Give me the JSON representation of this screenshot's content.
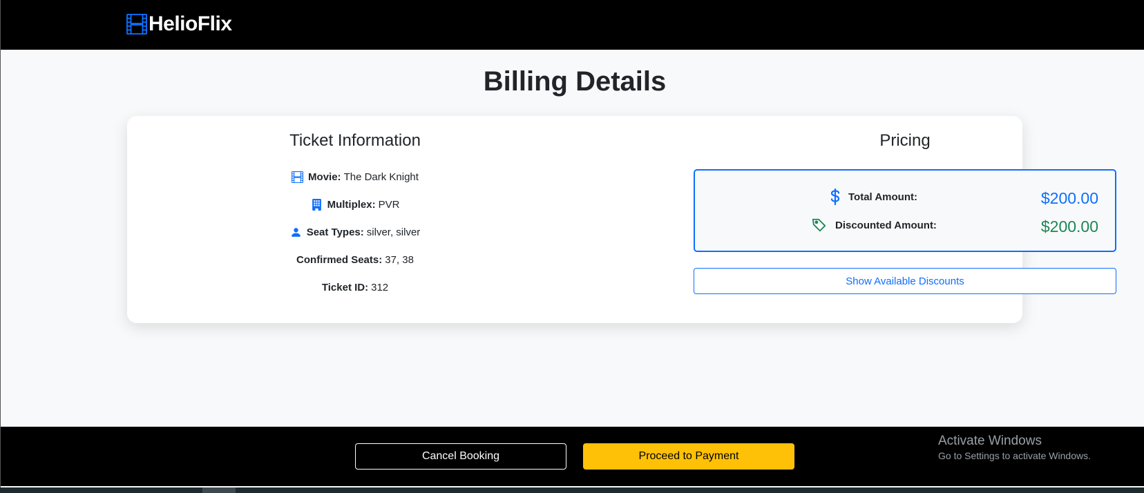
{
  "brand": {
    "name": "HelioFlix",
    "icon": "film-icon"
  },
  "page": {
    "title": "Billing Details"
  },
  "ticket": {
    "title": "Ticket Information",
    "rows": [
      {
        "icon": "film-icon",
        "label": "Movie:",
        "value": "The Dark Knight"
      },
      {
        "icon": "building-icon",
        "label": "Multiplex:",
        "value": "PVR"
      },
      {
        "icon": "person-icon",
        "label": "Seat Types:",
        "value": "silver, silver"
      },
      {
        "icon": "",
        "label": "Confirmed Seats:",
        "value": "37, 38"
      },
      {
        "icon": "",
        "label": "Ticket ID:",
        "value": "312"
      }
    ]
  },
  "pricing": {
    "title": "Pricing",
    "total": {
      "icon": "dollar-icon",
      "label": "Total Amount:",
      "value": "$200.00"
    },
    "discounted": {
      "icon": "tag-icon",
      "label": "Discounted Amount:",
      "value": "$200.00"
    },
    "discount_button": "Show Available Discounts"
  },
  "footer": {
    "cancel_label": "Cancel Booking",
    "pay_label": "Proceed to Payment"
  },
  "watermark": {
    "title": "Activate Windows",
    "subtitle": "Go to Settings to activate Windows."
  },
  "colors": {
    "primary": "#0d6efd",
    "success": "#198754",
    "warning": "#ffc107",
    "nav_bg": "#000000"
  }
}
